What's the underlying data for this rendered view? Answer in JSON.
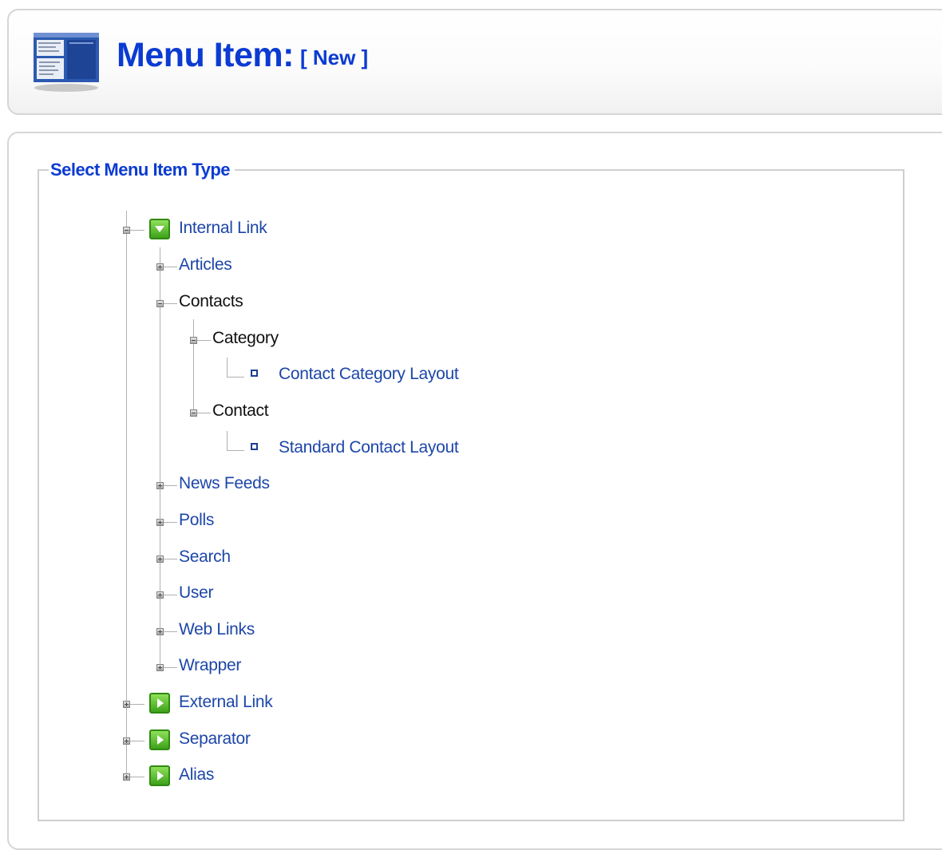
{
  "header": {
    "title": "Menu Item:",
    "subtitle": "[ New ]"
  },
  "fieldset": {
    "legend": "Select Menu Item Type"
  },
  "tree": {
    "internal_link": "Internal Link",
    "articles": "Articles",
    "contacts": "Contacts",
    "category": "Category",
    "contact_category_layout": "Contact Category Layout",
    "contact": "Contact",
    "standard_contact_layout": "Standard Contact Layout",
    "news_feeds": "News Feeds",
    "polls": "Polls",
    "search": "Search",
    "user": "User",
    "web_links": "Web Links",
    "wrapper": "Wrapper",
    "external_link": "External Link",
    "separator": "Separator",
    "alias": "Alias"
  },
  "colors": {
    "title": "#0b3bd2",
    "link": "#1d46a8",
    "folder_green": "#3ea11b",
    "border": "#d6d6d6"
  },
  "icons": {
    "page_icon": "menu-item-page-icon",
    "folder_open": "green-folder-open-icon",
    "folder_closed": "green-folder-closed-icon",
    "leaf": "square-bullet-icon",
    "expand": "plus-toggle-icon",
    "collapse": "minus-toggle-icon"
  }
}
